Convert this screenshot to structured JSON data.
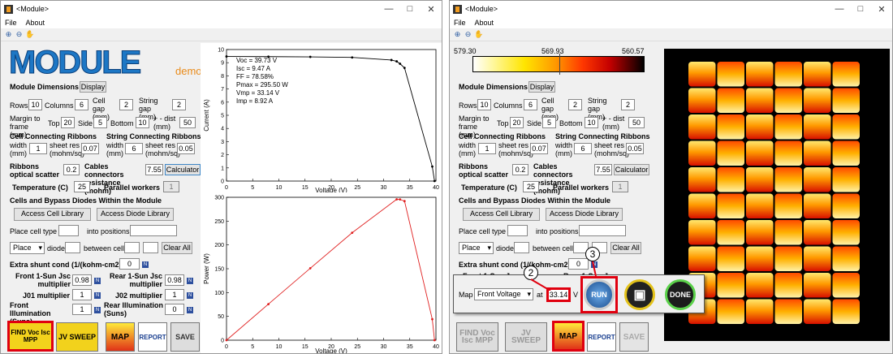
{
  "left": {
    "window_title": "<Module>",
    "menu": [
      "File",
      "About"
    ],
    "logo_text": "MODULE",
    "logo_sub": "demo",
    "module_dimensions": "Module Dimensions",
    "display_btn": "Display",
    "rows_label": "Rows",
    "rows": "10",
    "columns_label": "Columns",
    "columns": "6",
    "cellgap_label": "Cell gap (mm)",
    "cellgap": "2",
    "stringgap_label": "String gap (mm)",
    "stringgap": "2",
    "margin_label": "Margin to frame (mm)",
    "top_label": "Top",
    "top": "20",
    "side_label": "Side",
    "side": "5",
    "bottom_label": "Bottom",
    "bottom": "10",
    "dist_label": "+ - dist (mm)",
    "dist": "50",
    "ccr_label": "Cell Connecting Ribbons",
    "scr_label": "String Connecting Ribbons",
    "width_label": "width (mm)",
    "ccr_width": "1",
    "sheet_label": "sheet res (mohm/sq)",
    "ccr_sheet": "0.07",
    "scr_width": "6",
    "scr_sheet": "0.05",
    "ribbons_label": "Ribbons optical scatter",
    "ribbons": "0.2",
    "cables_label": "Cables connectors resistance (mohm)",
    "cables": "7.55",
    "calc_btn": "Calculator",
    "temp_label": "Temperature (C)",
    "temp": "25",
    "workers_label": "Parallel workers",
    "workers": "1",
    "cells_header": "Cells and Bypass Diodes Within the Module",
    "cell_lib_btn": "Access Cell Library",
    "diode_lib_btn": "Access Diode Library",
    "place_cell_label": "Place cell type",
    "into_label": "into positions",
    "place_dd": "Place",
    "diode_label": "diode",
    "between_label": "between cells",
    "clear_btn": "Clear All",
    "shunt_label": "Extra shunt cond (1/(kohm-cm2))",
    "shunt": "0",
    "front_jsc_label": "Front 1-Sun Jsc multiplier",
    "front_jsc": "0.98",
    "rear_jsc_label": "Rear 1-Sun Jsc multiplier",
    "rear_jsc": "0.98",
    "j01_label": "J01 multiplier",
    "j01": "1",
    "j02_label": "J02 multiplier",
    "j02": "1",
    "front_ill_label": "Front Illumination (Suns)",
    "front_ill": "1",
    "rear_ill_label": "Rear Illumination (Suns)",
    "rear_ill": "0",
    "btn_find": "FIND Voc Isc MPP",
    "btn_jv": "JV SWEEP",
    "btn_map": "MAP",
    "btn_report": "REPORT",
    "btn_save": "SAVE",
    "results": [
      "Voc = 39.73 V",
      "Isc = 9.47 A",
      "FF = 78.58%",
      "Pmax = 295.50 W",
      "Vmp = 33.14 V",
      "Imp = 8.92 A"
    ]
  },
  "right": {
    "window_title": "<Module>",
    "menu": [
      "File",
      "About"
    ],
    "colorbar_ticks": [
      "579.30",
      "569.93",
      "560.57"
    ],
    "map_label": "Map",
    "map_dd": "Front Voltage",
    "at_label": "at",
    "at_value": "33.14",
    "v_label": "V",
    "run_btn": "RUN",
    "done_btn": "DONE",
    "callout_2": "2",
    "callout_3": "3",
    "partial_frontjsc": "Front 1-Sun Jsc",
    "partial_rear": "Rear 1-Sun Jsc"
  },
  "chart_data": [
    {
      "type": "line",
      "title": "",
      "xlabel": "Voltage (V)",
      "ylabel": "Current (A)",
      "xlim": [
        0,
        40
      ],
      "ylim": [
        0,
        10
      ],
      "xticks": [
        0,
        5,
        10,
        15,
        20,
        25,
        30,
        35,
        40
      ],
      "yticks": [
        0,
        1,
        2,
        3,
        4,
        5,
        6,
        7,
        8,
        9,
        10
      ],
      "series": [
        {
          "color": "#000000",
          "x": [
            0,
            8,
            16,
            24,
            31.5,
            32.5,
            33.14,
            34,
            39.3,
            39.73
          ],
          "y": [
            9.47,
            9.46,
            9.44,
            9.4,
            9.2,
            9.1,
            8.92,
            8.6,
            1.1,
            0
          ]
        }
      ]
    },
    {
      "type": "line",
      "title": "",
      "xlabel": "Voltage (V)",
      "ylabel": "Power (W)",
      "xlim": [
        0,
        40
      ],
      "ylim": [
        0,
        300
      ],
      "xticks": [
        0,
        5,
        10,
        15,
        20,
        25,
        30,
        35,
        40
      ],
      "yticks": [
        0,
        50,
        100,
        150,
        200,
        250,
        300
      ],
      "series": [
        {
          "color": "#e02020",
          "x": [
            0,
            8,
            16,
            24,
            32.5,
            33.14,
            34,
            39.3,
            39.73
          ],
          "y": [
            0,
            75.7,
            151,
            225.6,
            295.8,
            295.5,
            292,
            44,
            0
          ]
        }
      ]
    }
  ]
}
